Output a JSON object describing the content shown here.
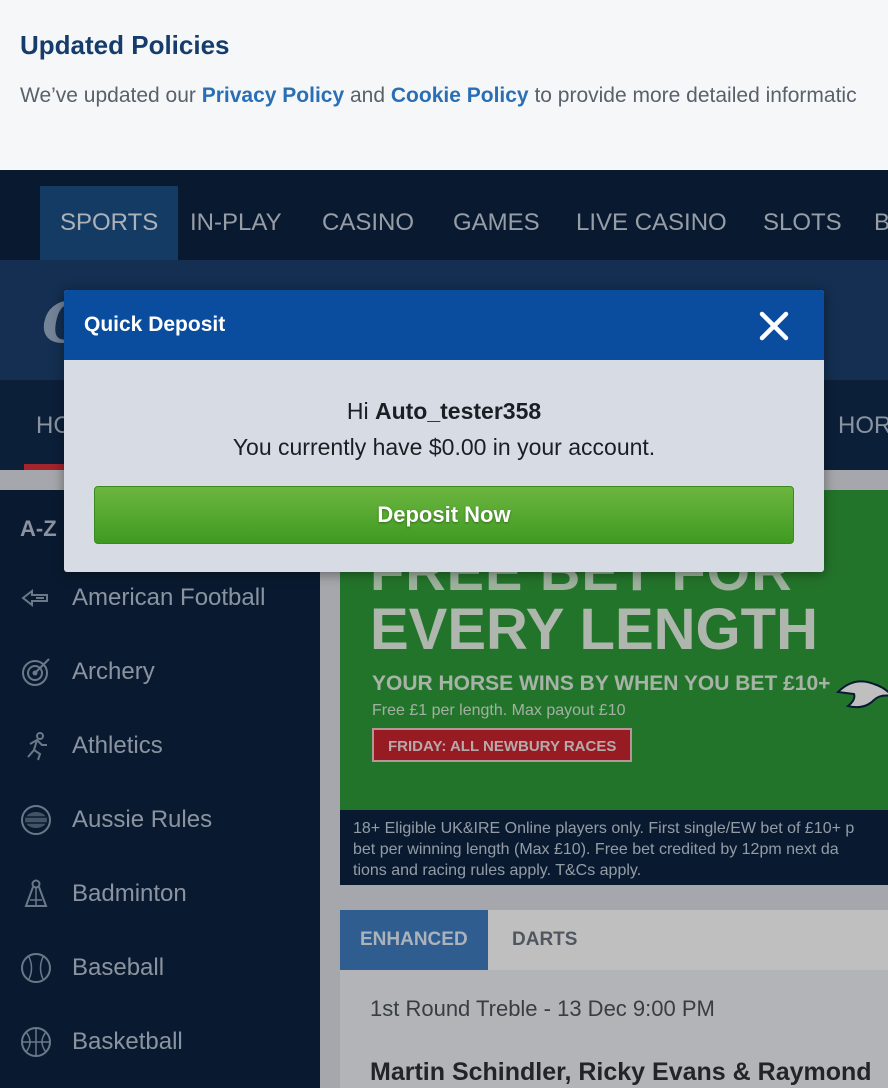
{
  "policy_banner": {
    "title": "Updated Policies",
    "text_before": "We’ve updated our ",
    "privacy_link": "Privacy Policy",
    "text_between": " and ",
    "cookie_link": "Cookie Policy",
    "text_after": " to provide more detailed informatic"
  },
  "top_nav": {
    "items": [
      "SPORTS",
      "IN-PLAY",
      "CASINO",
      "GAMES",
      "LIVE CASINO",
      "SLOTS",
      "B"
    ],
    "active": "SPORTS"
  },
  "brand_band": {
    "logo_text": "C"
  },
  "sport_tabs": {
    "left_label": "HC",
    "right_label": "HOR"
  },
  "sidebar": {
    "heading": "A-Z",
    "items": [
      {
        "label": "American Football",
        "icon": "american-football-icon"
      },
      {
        "label": "Archery",
        "icon": "archery-target-icon"
      },
      {
        "label": "Athletics",
        "icon": "runner-icon"
      },
      {
        "label": "Aussie Rules",
        "icon": "aussie-rules-ball-icon"
      },
      {
        "label": "Badminton",
        "icon": "shuttlecock-icon"
      },
      {
        "label": "Baseball",
        "icon": "baseball-icon"
      },
      {
        "label": "Basketball",
        "icon": "basketball-icon"
      }
    ]
  },
  "promo": {
    "top_line": "FREE BET FOR",
    "headline": "EVERY LENGTH",
    "subline": "YOUR HORSE WINS BY WHEN YOU BET £10+",
    "small": "Free £1 per length. Max payout £10",
    "badge": "FRIDAY: ALL NEWBURY RACES",
    "terms_1": "18+ Eligible UK&IRE Online players only. First single/EW bet of £10+ p",
    "terms_2": "bet per winning length (Max £10). Free bet credited by 12pm next da",
    "terms_3": "tions and racing rules apply. T&Cs apply."
  },
  "market_tabs": {
    "items": [
      "ENHANCED",
      "DARTS"
    ],
    "active": "ENHANCED"
  },
  "market": {
    "date_line": "1st Round Treble - 13 Dec 9:00 PM",
    "title": "Martin Schindler, Ricky Evans & Raymond"
  },
  "modal": {
    "title": "Quick Deposit",
    "greeting_prefix": "Hi ",
    "username": "Auto_tester358",
    "balance_text": "You currently have $0.00 in your account.",
    "button_label": "Deposit Now",
    "close_icon": "close-icon"
  },
  "colors": {
    "header_navy": "#0c2340",
    "modal_blue": "#0a4c9e",
    "deposit_green": "#4fa62c",
    "promo_green": "#2f9b3a",
    "link_blue": "#2a6fb5"
  }
}
